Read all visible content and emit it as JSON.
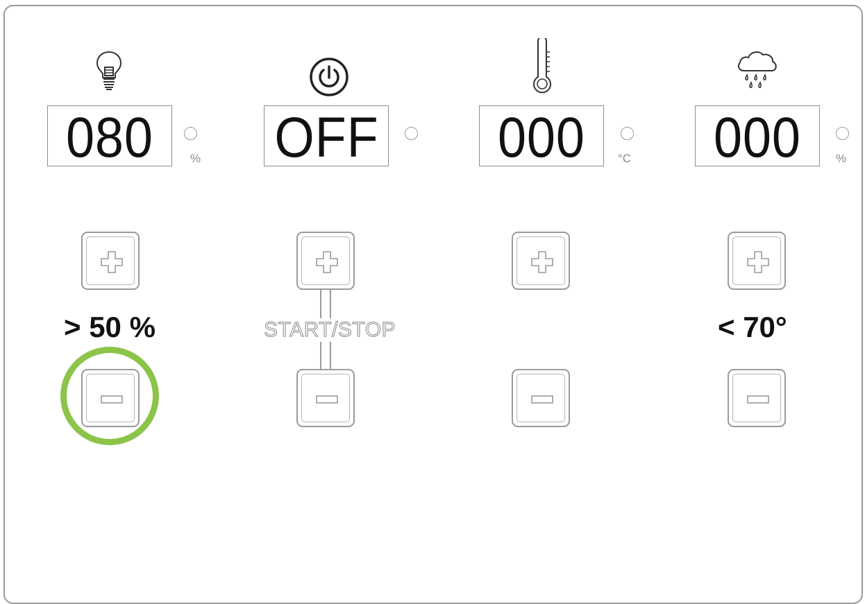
{
  "channels": [
    {
      "id": "light",
      "icon": "light-bulb-icon",
      "display_value": "080",
      "unit": "%",
      "threshold": "> 50 %"
    },
    {
      "id": "power",
      "icon": "power-icon",
      "display_value": "OFF",
      "unit": "",
      "center_label": "START/STOP"
    },
    {
      "id": "temperature",
      "icon": "thermometer-icon",
      "display_value": "000",
      "unit": "°C"
    },
    {
      "id": "humidity",
      "icon": "rain-cloud-icon",
      "display_value": "000",
      "unit": "%",
      "threshold": "< 70°"
    }
  ],
  "colors": {
    "highlight": "#8cc44a",
    "outline": "#9a9a9a",
    "text": "#111111"
  },
  "highlighted_control": "light-minus-button"
}
